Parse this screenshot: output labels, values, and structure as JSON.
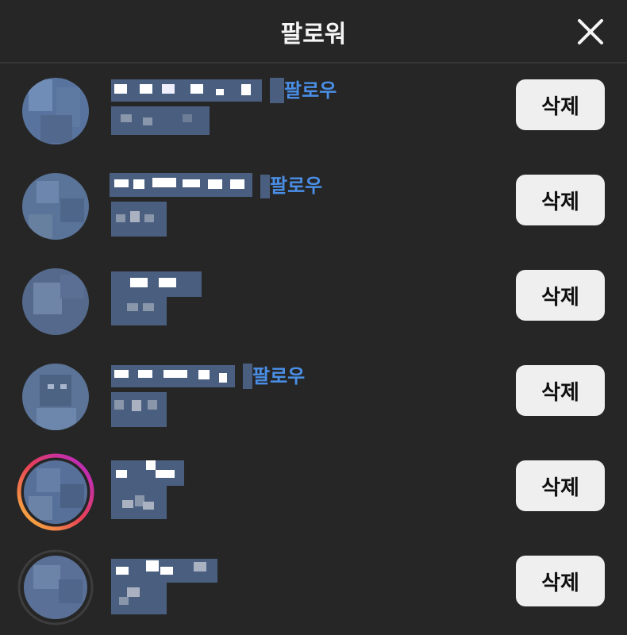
{
  "header": {
    "title": "팔로워",
    "close_icon": "close-icon"
  },
  "rows": [
    {
      "follow_label": "팔로우",
      "remove_label": "삭제"
    },
    {
      "follow_label": "팔로우",
      "remove_label": "삭제"
    },
    {
      "follow_label": "",
      "remove_label": "삭제"
    },
    {
      "follow_label": "팔로우",
      "remove_label": "삭제"
    },
    {
      "follow_label": "",
      "remove_label": "삭제"
    },
    {
      "follow_label": "",
      "remove_label": "삭제"
    }
  ],
  "colors": {
    "background": "#262626",
    "link": "#4a8fe7",
    "button": "#efefef",
    "blur": "#4a5f80"
  }
}
